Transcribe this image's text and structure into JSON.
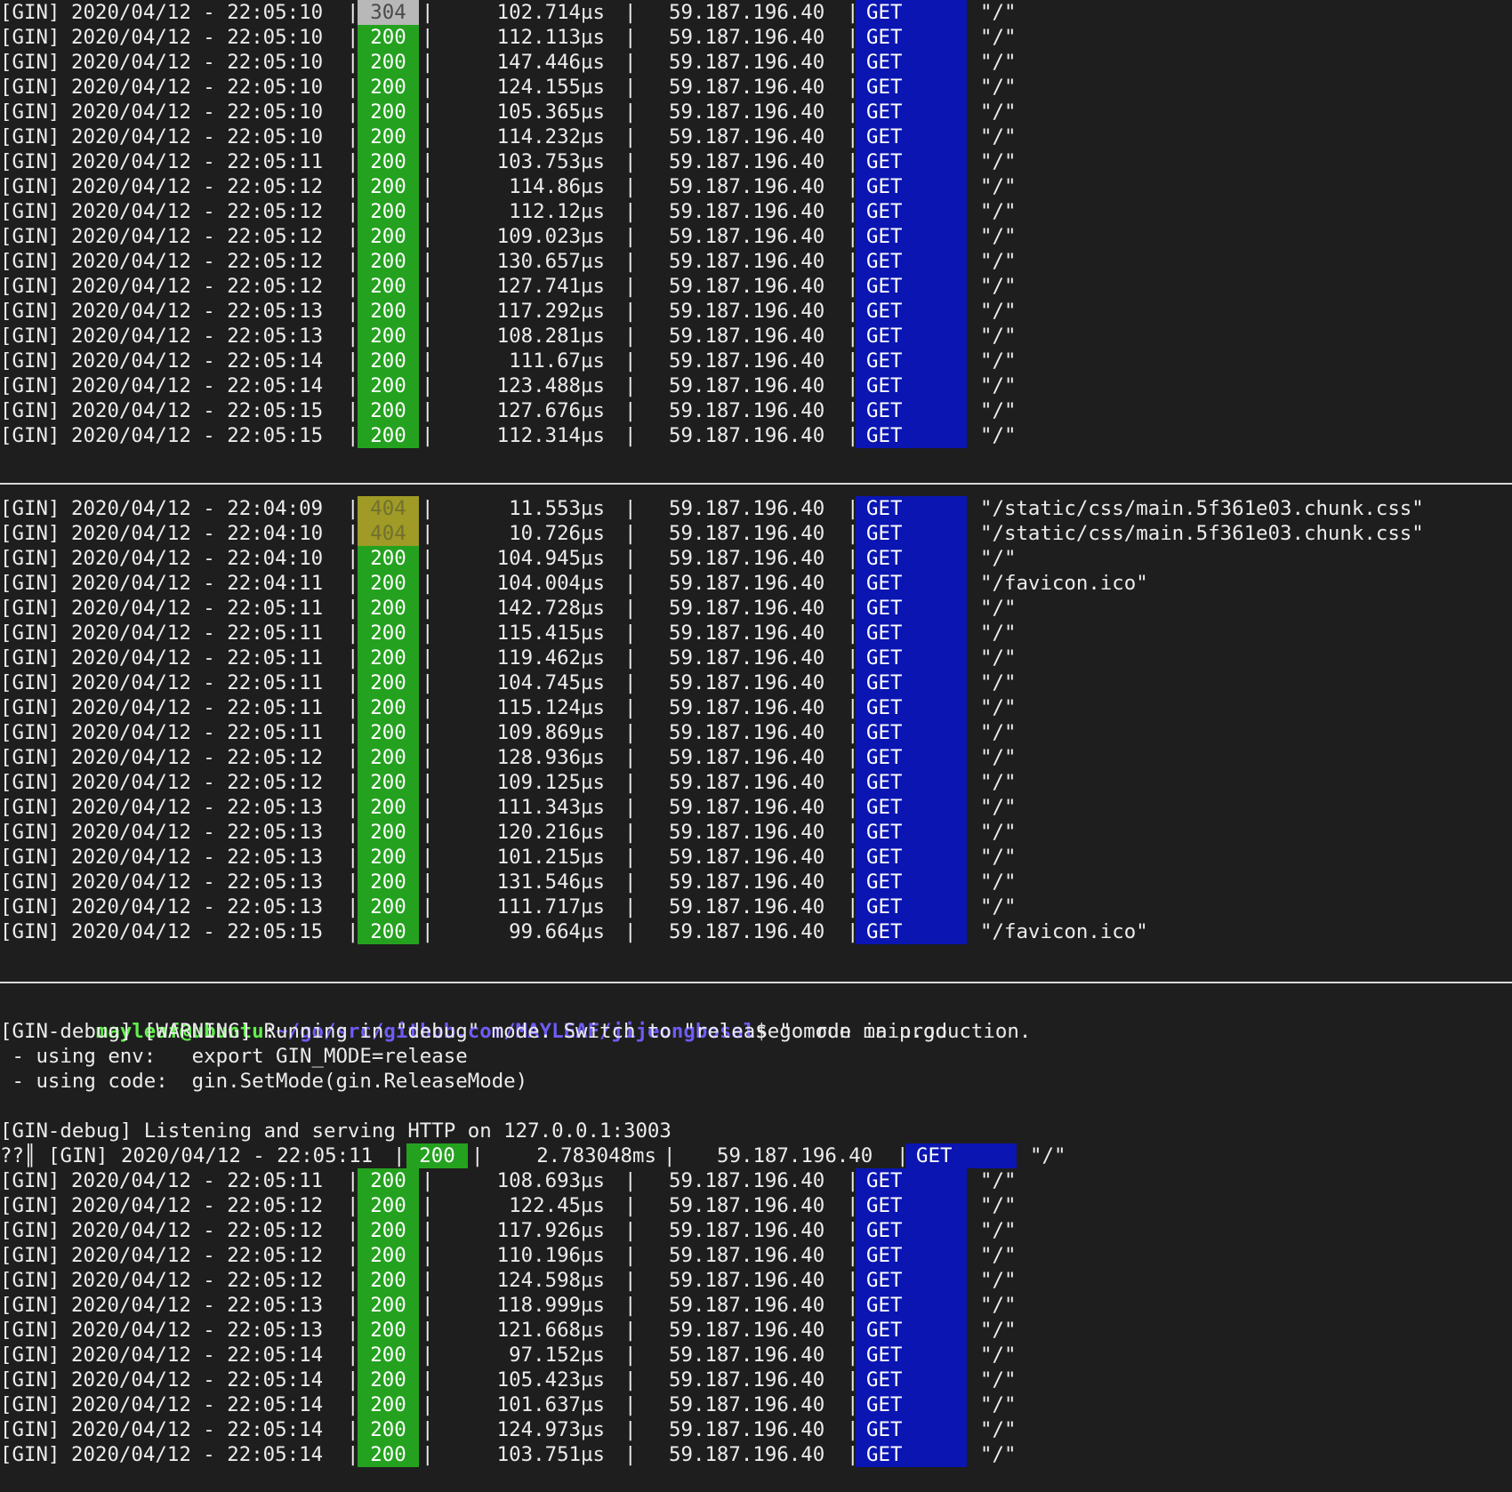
{
  "theme": {
    "background": "#1e1e1e",
    "text": "#ececec",
    "status_200_bg": "#24a21f",
    "status_304_bg": "#b8b8b8",
    "status_404_bg": "#a09a26",
    "method_get_bg": "#0a15b2",
    "prompt_user_color": "#5ff04a",
    "prompt_path_color": "#6d5cf5"
  },
  "pane1": {
    "rows": [
      {
        "prefix": "[GIN]",
        "timestamp": "2020/04/12 - 22:05:10",
        "status": "304",
        "latency": "102.714µs",
        "ip": "59.187.196.40",
        "method": "GET",
        "path": "\"/\""
      },
      {
        "prefix": "[GIN]",
        "timestamp": "2020/04/12 - 22:05:10",
        "status": "200",
        "latency": "112.113µs",
        "ip": "59.187.196.40",
        "method": "GET",
        "path": "\"/\""
      },
      {
        "prefix": "[GIN]",
        "timestamp": "2020/04/12 - 22:05:10",
        "status": "200",
        "latency": "147.446µs",
        "ip": "59.187.196.40",
        "method": "GET",
        "path": "\"/\""
      },
      {
        "prefix": "[GIN]",
        "timestamp": "2020/04/12 - 22:05:10",
        "status": "200",
        "latency": "124.155µs",
        "ip": "59.187.196.40",
        "method": "GET",
        "path": "\"/\""
      },
      {
        "prefix": "[GIN]",
        "timestamp": "2020/04/12 - 22:05:10",
        "status": "200",
        "latency": "105.365µs",
        "ip": "59.187.196.40",
        "method": "GET",
        "path": "\"/\""
      },
      {
        "prefix": "[GIN]",
        "timestamp": "2020/04/12 - 22:05:10",
        "status": "200",
        "latency": "114.232µs",
        "ip": "59.187.196.40",
        "method": "GET",
        "path": "\"/\""
      },
      {
        "prefix": "[GIN]",
        "timestamp": "2020/04/12 - 22:05:11",
        "status": "200",
        "latency": "103.753µs",
        "ip": "59.187.196.40",
        "method": "GET",
        "path": "\"/\""
      },
      {
        "prefix": "[GIN]",
        "timestamp": "2020/04/12 - 22:05:12",
        "status": "200",
        "latency": "114.86µs",
        "ip": "59.187.196.40",
        "method": "GET",
        "path": "\"/\""
      },
      {
        "prefix": "[GIN]",
        "timestamp": "2020/04/12 - 22:05:12",
        "status": "200",
        "latency": "112.12µs",
        "ip": "59.187.196.40",
        "method": "GET",
        "path": "\"/\""
      },
      {
        "prefix": "[GIN]",
        "timestamp": "2020/04/12 - 22:05:12",
        "status": "200",
        "latency": "109.023µs",
        "ip": "59.187.196.40",
        "method": "GET",
        "path": "\"/\""
      },
      {
        "prefix": "[GIN]",
        "timestamp": "2020/04/12 - 22:05:12",
        "status": "200",
        "latency": "130.657µs",
        "ip": "59.187.196.40",
        "method": "GET",
        "path": "\"/\""
      },
      {
        "prefix": "[GIN]",
        "timestamp": "2020/04/12 - 22:05:12",
        "status": "200",
        "latency": "127.741µs",
        "ip": "59.187.196.40",
        "method": "GET",
        "path": "\"/\""
      },
      {
        "prefix": "[GIN]",
        "timestamp": "2020/04/12 - 22:05:13",
        "status": "200",
        "latency": "117.292µs",
        "ip": "59.187.196.40",
        "method": "GET",
        "path": "\"/\""
      },
      {
        "prefix": "[GIN]",
        "timestamp": "2020/04/12 - 22:05:13",
        "status": "200",
        "latency": "108.281µs",
        "ip": "59.187.196.40",
        "method": "GET",
        "path": "\"/\""
      },
      {
        "prefix": "[GIN]",
        "timestamp": "2020/04/12 - 22:05:14",
        "status": "200",
        "latency": "111.67µs",
        "ip": "59.187.196.40",
        "method": "GET",
        "path": "\"/\""
      },
      {
        "prefix": "[GIN]",
        "timestamp": "2020/04/12 - 22:05:14",
        "status": "200",
        "latency": "123.488µs",
        "ip": "59.187.196.40",
        "method": "GET",
        "path": "\"/\""
      },
      {
        "prefix": "[GIN]",
        "timestamp": "2020/04/12 - 22:05:15",
        "status": "200",
        "latency": "127.676µs",
        "ip": "59.187.196.40",
        "method": "GET",
        "path": "\"/\""
      },
      {
        "prefix": "[GIN]",
        "timestamp": "2020/04/12 - 22:05:15",
        "status": "200",
        "latency": "112.314µs",
        "ip": "59.187.196.40",
        "method": "GET",
        "path": "\"/\""
      }
    ]
  },
  "pane2": {
    "rows": [
      {
        "prefix": "[GIN]",
        "timestamp": "2020/04/12 - 22:04:09",
        "status": "404",
        "latency": "11.553µs",
        "ip": "59.187.196.40",
        "method": "GET",
        "path": "\"/static/css/main.5f361e03.chunk.css\""
      },
      {
        "prefix": "[GIN]",
        "timestamp": "2020/04/12 - 22:04:10",
        "status": "404",
        "latency": "10.726µs",
        "ip": "59.187.196.40",
        "method": "GET",
        "path": "\"/static/css/main.5f361e03.chunk.css\""
      },
      {
        "prefix": "[GIN]",
        "timestamp": "2020/04/12 - 22:04:10",
        "status": "200",
        "latency": "104.945µs",
        "ip": "59.187.196.40",
        "method": "GET",
        "path": "\"/\""
      },
      {
        "prefix": "[GIN]",
        "timestamp": "2020/04/12 - 22:04:11",
        "status": "200",
        "latency": "104.004µs",
        "ip": "59.187.196.40",
        "method": "GET",
        "path": "\"/favicon.ico\""
      },
      {
        "prefix": "[GIN]",
        "timestamp": "2020/04/12 - 22:05:11",
        "status": "200",
        "latency": "142.728µs",
        "ip": "59.187.196.40",
        "method": "GET",
        "path": "\"/\""
      },
      {
        "prefix": "[GIN]",
        "timestamp": "2020/04/12 - 22:05:11",
        "status": "200",
        "latency": "115.415µs",
        "ip": "59.187.196.40",
        "method": "GET",
        "path": "\"/\""
      },
      {
        "prefix": "[GIN]",
        "timestamp": "2020/04/12 - 22:05:11",
        "status": "200",
        "latency": "119.462µs",
        "ip": "59.187.196.40",
        "method": "GET",
        "path": "\"/\""
      },
      {
        "prefix": "[GIN]",
        "timestamp": "2020/04/12 - 22:05:11",
        "status": "200",
        "latency": "104.745µs",
        "ip": "59.187.196.40",
        "method": "GET",
        "path": "\"/\""
      },
      {
        "prefix": "[GIN]",
        "timestamp": "2020/04/12 - 22:05:11",
        "status": "200",
        "latency": "115.124µs",
        "ip": "59.187.196.40",
        "method": "GET",
        "path": "\"/\""
      },
      {
        "prefix": "[GIN]",
        "timestamp": "2020/04/12 - 22:05:11",
        "status": "200",
        "latency": "109.869µs",
        "ip": "59.187.196.40",
        "method": "GET",
        "path": "\"/\""
      },
      {
        "prefix": "[GIN]",
        "timestamp": "2020/04/12 - 22:05:12",
        "status": "200",
        "latency": "128.936µs",
        "ip": "59.187.196.40",
        "method": "GET",
        "path": "\"/\""
      },
      {
        "prefix": "[GIN]",
        "timestamp": "2020/04/12 - 22:05:12",
        "status": "200",
        "latency": "109.125µs",
        "ip": "59.187.196.40",
        "method": "GET",
        "path": "\"/\""
      },
      {
        "prefix": "[GIN]",
        "timestamp": "2020/04/12 - 22:05:13",
        "status": "200",
        "latency": "111.343µs",
        "ip": "59.187.196.40",
        "method": "GET",
        "path": "\"/\""
      },
      {
        "prefix": "[GIN]",
        "timestamp": "2020/04/12 - 22:05:13",
        "status": "200",
        "latency": "120.216µs",
        "ip": "59.187.196.40",
        "method": "GET",
        "path": "\"/\""
      },
      {
        "prefix": "[GIN]",
        "timestamp": "2020/04/12 - 22:05:13",
        "status": "200",
        "latency": "101.215µs",
        "ip": "59.187.196.40",
        "method": "GET",
        "path": "\"/\""
      },
      {
        "prefix": "[GIN]",
        "timestamp": "2020/04/12 - 22:05:13",
        "status": "200",
        "latency": "131.546µs",
        "ip": "59.187.196.40",
        "method": "GET",
        "path": "\"/\""
      },
      {
        "prefix": "[GIN]",
        "timestamp": "2020/04/12 - 22:05:13",
        "status": "200",
        "latency": "111.717µs",
        "ip": "59.187.196.40",
        "method": "GET",
        "path": "\"/\""
      },
      {
        "prefix": "[GIN]",
        "timestamp": "2020/04/12 - 22:05:15",
        "status": "200",
        "latency": "99.664µs",
        "ip": "59.187.196.40",
        "method": "GET",
        "path": "\"/favicon.ico\""
      }
    ]
  },
  "pane3": {
    "prompt": {
      "user_host": "mayleaf@ubuntu",
      "separator": ":",
      "path": "~/go/src/github.com/MAYLEAF/jijeongbosal",
      "symbol": "$",
      "command": " go run main.go"
    },
    "messages": [
      "[GIN-debug] [WARNING] Running in \"debug\" mode. Switch to \"release\" mode in production.",
      " - using env:   export GIN_MODE=release",
      " - using code:  gin.SetMode(gin.ReleaseMode)",
      "",
      "[GIN-debug] Listening and serving HTTP on 127.0.0.1:3003"
    ],
    "first_row": {
      "garble": "??║",
      "prefix": "[GIN]",
      "timestamp": "2020/04/12 - 22:05:11",
      "status": "200",
      "latency": "2.783048ms",
      "ip": "59.187.196.40",
      "method": "GET",
      "path": "\"/\""
    },
    "rows": [
      {
        "prefix": "[GIN]",
        "timestamp": "2020/04/12 - 22:05:11",
        "status": "200",
        "latency": "108.693µs",
        "ip": "59.187.196.40",
        "method": "GET",
        "path": "\"/\""
      },
      {
        "prefix": "[GIN]",
        "timestamp": "2020/04/12 - 22:05:12",
        "status": "200",
        "latency": "122.45µs",
        "ip": "59.187.196.40",
        "method": "GET",
        "path": "\"/\""
      },
      {
        "prefix": "[GIN]",
        "timestamp": "2020/04/12 - 22:05:12",
        "status": "200",
        "latency": "117.926µs",
        "ip": "59.187.196.40",
        "method": "GET",
        "path": "\"/\""
      },
      {
        "prefix": "[GIN]",
        "timestamp": "2020/04/12 - 22:05:12",
        "status": "200",
        "latency": "110.196µs",
        "ip": "59.187.196.40",
        "method": "GET",
        "path": "\"/\""
      },
      {
        "prefix": "[GIN]",
        "timestamp": "2020/04/12 - 22:05:12",
        "status": "200",
        "latency": "124.598µs",
        "ip": "59.187.196.40",
        "method": "GET",
        "path": "\"/\""
      },
      {
        "prefix": "[GIN]",
        "timestamp": "2020/04/12 - 22:05:13",
        "status": "200",
        "latency": "118.999µs",
        "ip": "59.187.196.40",
        "method": "GET",
        "path": "\"/\""
      },
      {
        "prefix": "[GIN]",
        "timestamp": "2020/04/12 - 22:05:13",
        "status": "200",
        "latency": "121.668µs",
        "ip": "59.187.196.40",
        "method": "GET",
        "path": "\"/\""
      },
      {
        "prefix": "[GIN]",
        "timestamp": "2020/04/12 - 22:05:14",
        "status": "200",
        "latency": "97.152µs",
        "ip": "59.187.196.40",
        "method": "GET",
        "path": "\"/\""
      },
      {
        "prefix": "[GIN]",
        "timestamp": "2020/04/12 - 22:05:14",
        "status": "200",
        "latency": "105.423µs",
        "ip": "59.187.196.40",
        "method": "GET",
        "path": "\"/\""
      },
      {
        "prefix": "[GIN]",
        "timestamp": "2020/04/12 - 22:05:14",
        "status": "200",
        "latency": "101.637µs",
        "ip": "59.187.196.40",
        "method": "GET",
        "path": "\"/\""
      },
      {
        "prefix": "[GIN]",
        "timestamp": "2020/04/12 - 22:05:14",
        "status": "200",
        "latency": "124.973µs",
        "ip": "59.187.196.40",
        "method": "GET",
        "path": "\"/\""
      },
      {
        "prefix": "[GIN]",
        "timestamp": "2020/04/12 - 22:05:14",
        "status": "200",
        "latency": "103.751µs",
        "ip": "59.187.196.40",
        "method": "GET",
        "path": "\"/\""
      }
    ]
  }
}
